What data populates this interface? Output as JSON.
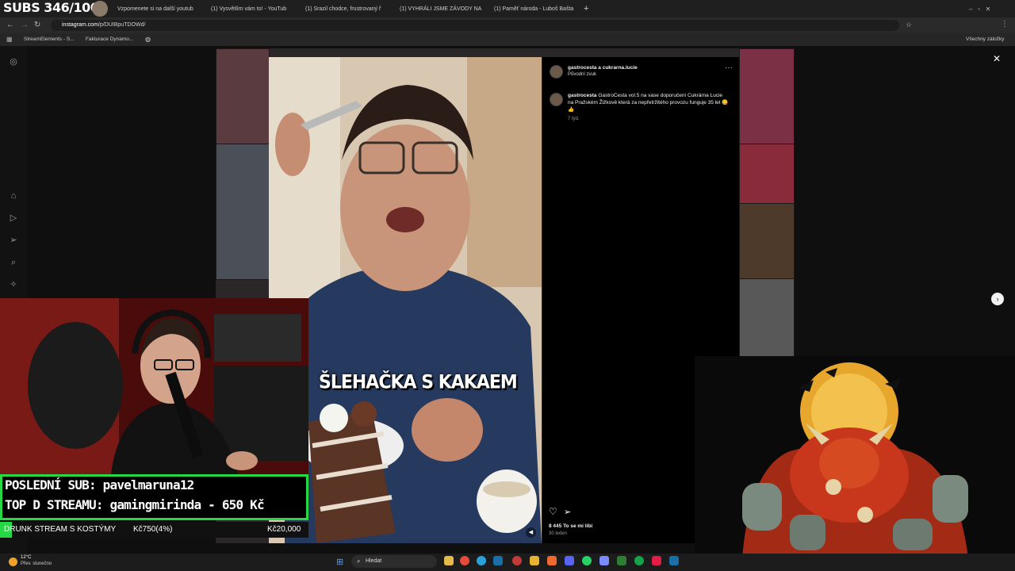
{
  "stream": {
    "subs_counter": "SUBS 346/1000"
  },
  "browser": {
    "tabs": [
      {
        "label": "Vzpomenete si na další youtub"
      },
      {
        "label": "(1) Vysvětlím vám to! - YouTub"
      },
      {
        "label": "(1) Srazil chodce, frustrovaný ř"
      },
      {
        "label": "(1) VYHRÁLI JSME ZÁVODY NA"
      },
      {
        "label": "(1) Paměť národa - Luboš Bašta"
      }
    ],
    "url_domain": "instagram.com",
    "url_path": "/p/DUIBpuTDOWd/",
    "bookmarks": [
      {
        "label": "StreamElements - S..."
      },
      {
        "label": "Fakturace Dynamo..."
      }
    ],
    "all_bookmarks": "Všechny záložky"
  },
  "post": {
    "author_header": "gastrocesta a cukrarna.lucie",
    "audio": "Původní zvuk",
    "caption_user": "gastrocesta",
    "caption_text": "GastroCesta vol.5 na vase doporučení Cukrárna Lucie na Pražském Žižkově která za nepřetržitého provozu funguje 35 let 😋👍",
    "caption_time": "7 týd.",
    "video_caption": "ŠLEHAČKA S KAKAEM",
    "likes": "8 445 To se mi líbí",
    "date": "30 leden"
  },
  "overlay": {
    "last_sub": "POSLEDNÍ SUB: pavelmaruna12",
    "top_donor": "TOP D STREAMU: gamingmirinda - 650 Kč",
    "goal_title": "DRUNK STREAM S KOSTÝMY",
    "goal_current": "Kč750(4%)",
    "goal_target": "Kč20,000",
    "goal_fraction": 0.0375
  },
  "taskbar": {
    "weather_temp": "12°C",
    "weather_desc": "Přev. slunečno",
    "search": "Hledat"
  },
  "colors": {
    "accent_green": "#27d845",
    "instagram_bg": "#000000"
  }
}
